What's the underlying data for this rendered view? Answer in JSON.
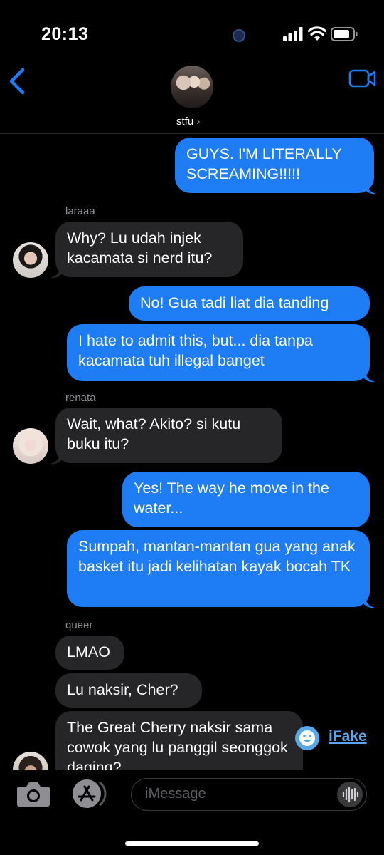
{
  "status_bar": {
    "time": "20:13"
  },
  "header": {
    "group_name": "stfu",
    "chevron": "›"
  },
  "messages": [
    {
      "from": "me",
      "text": "GUYS. I'M LITERALLY SCREAMING!!!!!"
    },
    {
      "from": "laraaa",
      "sender_label": "laraaa",
      "text": "Why? Lu udah injek kacamata si nerd itu?"
    },
    {
      "from": "me",
      "text": "No! Gua tadi liat dia tanding"
    },
    {
      "from": "me",
      "text": "I hate to admit this, but... dia tanpa kacamata tuh illegal banget"
    },
    {
      "from": "renata",
      "sender_label": "renata",
      "text": "Wait, what? Akito? si kutu buku itu?"
    },
    {
      "from": "me",
      "text": "Yes! The way he move in the water..."
    },
    {
      "from": "me",
      "text": "Sumpah, mantan-mantan gua yang anak basket itu jadi kelihatan kayak bocah TK"
    },
    {
      "from": "queer",
      "sender_label": "queer",
      "text": "LMAO"
    },
    {
      "from": "queer",
      "text": "Lu naksir, Cher?"
    },
    {
      "from": "queer",
      "text": "The Great Cherry naksir sama cowok yang lu panggil seonggok daging?"
    }
  ],
  "composer": {
    "placeholder": "iMessage"
  },
  "watermark": {
    "text": "iFake"
  },
  "colors": {
    "outgoing": "#1e7cf5",
    "incoming": "#262628",
    "accent": "#1e7cf5",
    "watermark": "#58a7e8"
  },
  "icons": [
    "back-chevron-icon",
    "video-camera-icon",
    "camera-icon",
    "app-store-icon",
    "voice-waveform-icon",
    "signal-icon",
    "wifi-icon",
    "battery-icon"
  ]
}
